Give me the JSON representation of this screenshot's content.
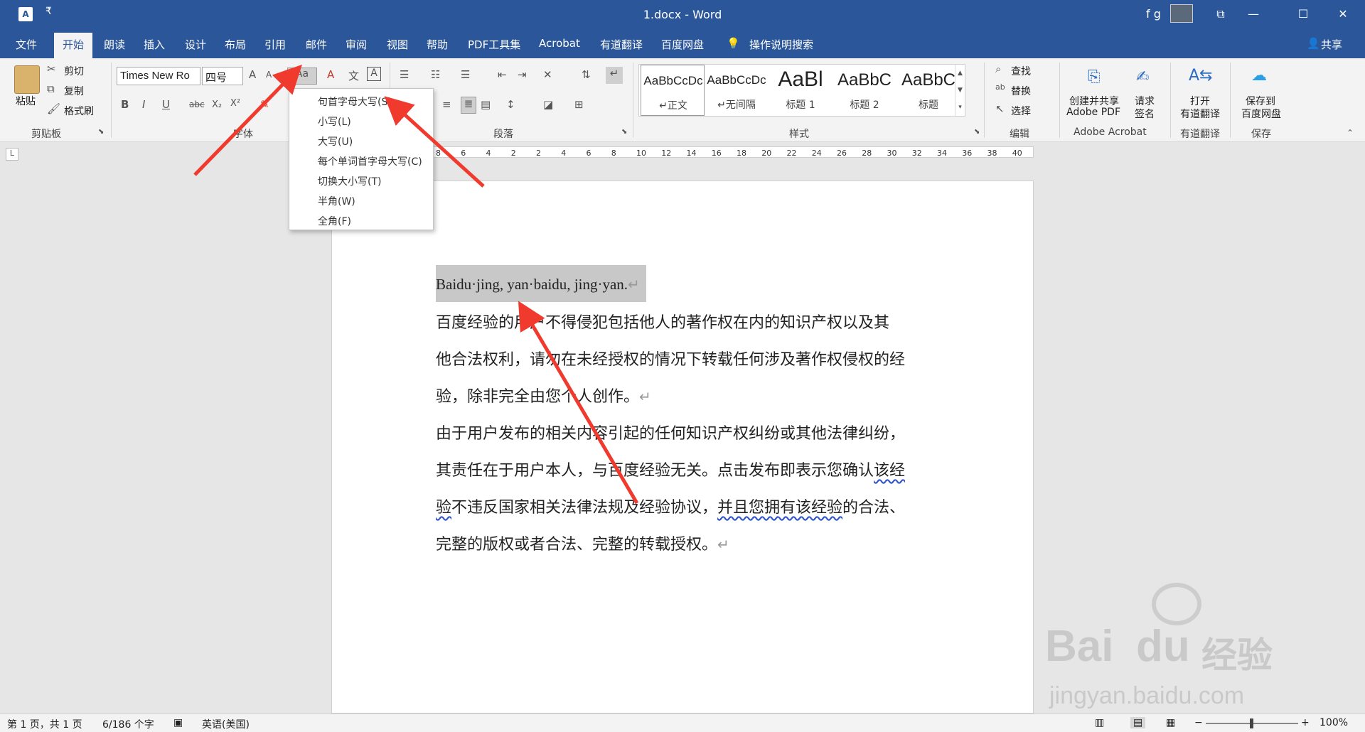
{
  "titlebar": {
    "app_icon": "A",
    "qa_label": "₹",
    "title": "1.docx - Word",
    "user": "f g",
    "minimize": "—",
    "restore": "❐",
    "maximize": "☐",
    "close": "✕",
    "ribbon_display": "⧉"
  },
  "tabs": {
    "file": "文件",
    "home": "开始",
    "read": "朗读",
    "insert": "插入",
    "design": "设计",
    "layout": "布局",
    "references": "引用",
    "mailings": "邮件",
    "review": "审阅",
    "view": "视图",
    "help": "帮助",
    "pdf": "PDF工具集",
    "acrobat": "Acrobat",
    "youdao": "有道翻译",
    "baidu": "百度网盘",
    "tellme": "操作说明搜索",
    "share": "共享"
  },
  "clipboard": {
    "paste": "粘贴",
    "cut": "剪切",
    "copy": "复制",
    "format_painter": "格式刷",
    "group": "剪贴板"
  },
  "font": {
    "name": "Times New Ro",
    "size": "四号",
    "bold": "B",
    "italic": "I",
    "underline": "U",
    "strike": "abc",
    "sub": "X₂",
    "sup": "X²",
    "grow": "A",
    "shrink": "A",
    "case": "Aa",
    "clear": "A",
    "phonetic": "文",
    "border": "A",
    "group": "字体"
  },
  "paragraph": {
    "group": "段落"
  },
  "styles": {
    "group": "样式",
    "items": [
      {
        "preview": "AaBbCcDc",
        "name": "↵正文"
      },
      {
        "preview": "AaBbCcDc",
        "name": "↵无间隔"
      },
      {
        "preview": "AaBl",
        "name": "标题 1"
      },
      {
        "preview": "AaBbC",
        "name": "标题 2"
      },
      {
        "preview": "AaBbC",
        "name": "标题"
      }
    ]
  },
  "editing": {
    "find": "查找",
    "replace": "替换",
    "select": "选择",
    "group": "编辑"
  },
  "acrobat": {
    "create_line1": "创建并共享",
    "create_line2": "Adobe PDF",
    "request_line1": "请求",
    "request_line2": "签名",
    "group": "Adobe Acrobat"
  },
  "youdao": {
    "open_line1": "打开",
    "open_line2": "有道翻译",
    "group": "有道翻译"
  },
  "save": {
    "line1": "保存到",
    "line2": "百度网盘",
    "group": "保存"
  },
  "ruler": {
    "tab_marker": "L",
    "numbers": [
      "8",
      "6",
      "4",
      "2",
      "2",
      "4",
      "6",
      "8",
      "10",
      "12",
      "14",
      "16",
      "18",
      "20",
      "22",
      "24",
      "26",
      "28",
      "30",
      "32",
      "34",
      "36",
      "38",
      "40"
    ]
  },
  "case_menu": {
    "sentence": "句首字母大写(S)",
    "lower": "小写(L)",
    "upper": "大写(U)",
    "capitalize": "每个单词首字母大写(C)",
    "toggle": "切换大小写(T)",
    "half": "半角(W)",
    "full": "全角(F)"
  },
  "document": {
    "line1": "Baidu·jing, yan·baidu, jing·yan.",
    "line2": "百度经验的用户不得侵犯包括他人的著作权在内的知识产权以及其",
    "line3": "他合法权利，请勿在未经授权的情况下转载任何涉及著作权侵权的经",
    "line4": "验，除非完全由您个人创作。",
    "line5": "由于用户发布的相关内容引起的任何知识产权纠纷或其他法律纠纷，",
    "line6a": "其责任在于用户本人，与百度经验无关。点击发布即表示您确认",
    "line6b": "该经",
    "line7a": "验",
    "line7b": "不违反国家相关法律法规及经验协议，",
    "line7c": "并且您拥有该经验",
    "line7d": "的合法、",
    "line8": "完整的版权或者合法、完整的转载授权。",
    "para_mark": "↵"
  },
  "statusbar": {
    "page": "第 1 页，共 1 页",
    "words": "6/186 个字",
    "lang": "英语(美国)",
    "zoom": "100%",
    "minus": "−",
    "plus": "+"
  },
  "watermark": {
    "line1": "Bai",
    "line2": "du",
    "line3": "经验",
    "url": "jingyan.baidu.com"
  },
  "colors": {
    "title_blue": "#2b579a",
    "arrow_red": "#f03a2e"
  }
}
